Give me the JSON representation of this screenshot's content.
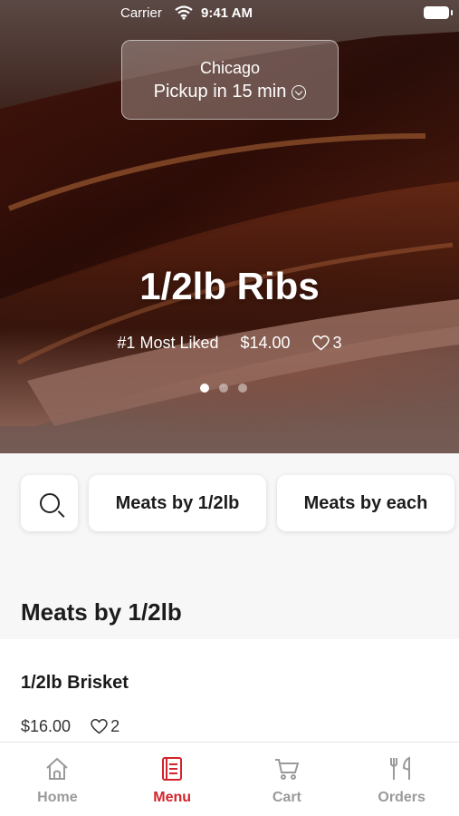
{
  "status_bar": {
    "carrier": "Carrier",
    "time": "9:41 AM"
  },
  "location": {
    "city": "Chicago",
    "pickup": "Pickup in 15 min"
  },
  "hero": {
    "title": "1/2lb Ribs",
    "tag": "#1 Most Liked",
    "price": "$14.00",
    "likes": "3",
    "carousel_index": 0,
    "carousel_count": 3
  },
  "categories": {
    "search_icon": "search-icon",
    "items": [
      {
        "label": "Meats by 1/2lb"
      },
      {
        "label": "Meats by each"
      }
    ]
  },
  "section": {
    "title": "Meats by 1/2lb"
  },
  "menu_item": {
    "name": "1/2lb Brisket",
    "price": "$16.00",
    "likes": "2"
  },
  "tabbar": {
    "active_color": "#d4232a",
    "inactive_color": "#9a9a9a",
    "tabs": [
      {
        "label": "Home",
        "icon": "home-icon"
      },
      {
        "label": "Menu",
        "icon": "menu-icon"
      },
      {
        "label": "Cart",
        "icon": "cart-icon"
      },
      {
        "label": "Orders",
        "icon": "orders-icon"
      }
    ]
  }
}
